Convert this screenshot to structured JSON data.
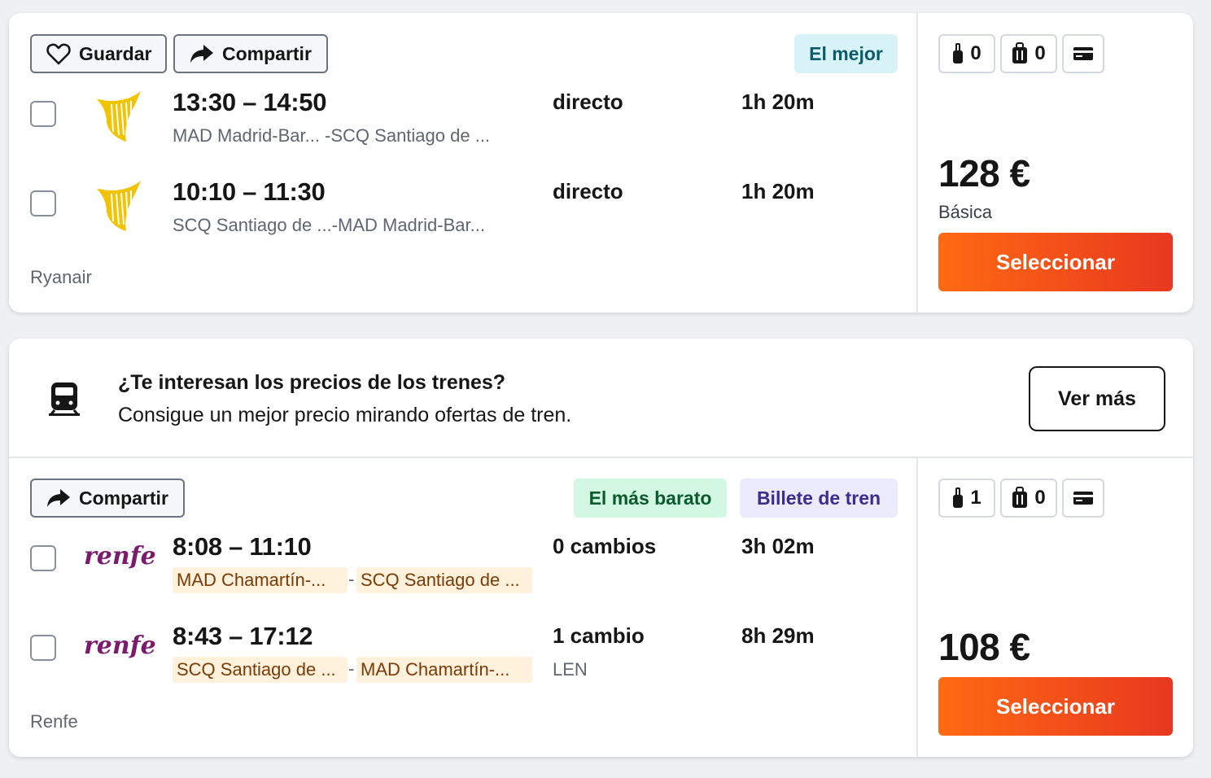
{
  "flight_card": {
    "actions": {
      "save": "Guardar",
      "share": "Compartir"
    },
    "badge": "El mejor",
    "legs": [
      {
        "times": "13:30 – 14:50",
        "route": "MAD Madrid-Bar... -SCQ Santiago de ...",
        "stops": "directo",
        "duration": "1h 20m"
      },
      {
        "times": "10:10 – 11:30",
        "route": "SCQ Santiago de ...-MAD Madrid-Bar...",
        "stops": "directo",
        "duration": "1h 20m"
      }
    ],
    "carrier": "Ryanair",
    "bags": {
      "carry_on": "0",
      "checked": "0"
    },
    "price": "128 €",
    "fare": "Básica",
    "select": "Seleccionar",
    "logo_icon": "ryanair-harp-icon",
    "logo_color": "#f1c300"
  },
  "train_promo": {
    "title": "¿Te interesan los precios de los trenes?",
    "subtitle": "Consigue un mejor precio mirando ofertas de tren.",
    "button": "Ver más",
    "icon": "train-icon"
  },
  "train_card": {
    "actions": {
      "share": "Compartir"
    },
    "badges": {
      "cheapest": "El más barato",
      "train": "Billete de tren"
    },
    "legs": [
      {
        "times": "8:08 – 11:10",
        "from": "MAD Chamartín-...",
        "to": "SCQ Santiago de ...",
        "stops": "0 cambios",
        "duration": "3h 02m",
        "via": ""
      },
      {
        "times": "8:43 – 17:12",
        "from": "SCQ Santiago de ...",
        "to": "MAD Chamartín-...",
        "stops": "1 cambio",
        "duration": "8h 29m",
        "via": "LEN"
      }
    ],
    "carrier": "Renfe",
    "logo_text": "renfe",
    "bags": {
      "carry_on": "1",
      "checked": "0"
    },
    "price": "108 €",
    "select": "Seleccionar",
    "logo_color": "#7a1b6e"
  },
  "colors": {
    "accent_orange": "#ff6a12",
    "best_badge_bg": "#d7f3f7",
    "best_badge_text": "#0b5b6b",
    "cheapest_badge_bg": "#d2f7e2",
    "cheapest_badge_text": "#0b5a2e",
    "train_badge_bg": "#ecebfd",
    "train_badge_text": "#3b2c8f"
  },
  "separator": "-"
}
